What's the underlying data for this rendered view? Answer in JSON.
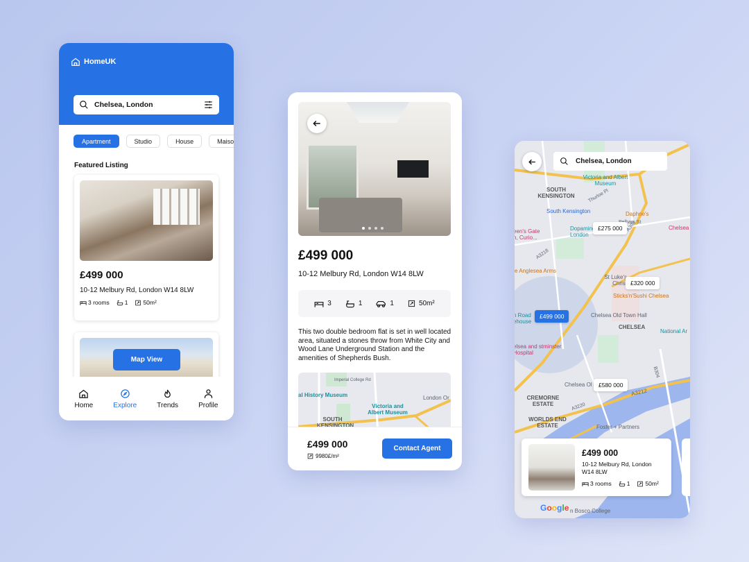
{
  "browse": {
    "brand": "HomeUK",
    "search_value": "Chelsea, London",
    "chips": [
      "Apartment",
      "Studio",
      "House",
      "Maisonette"
    ],
    "section_title": "Featured Listing",
    "listing": {
      "price": "£499 000",
      "address": "10-12 Melbury Rd, London W14 8LW",
      "rooms": "3 rooms",
      "baths": "1",
      "area": "50m²"
    },
    "map_view_label": "Map View",
    "nav": [
      {
        "label": "Home",
        "icon": "home-icon"
      },
      {
        "label": "Explore",
        "icon": "compass-icon"
      },
      {
        "label": "Trends",
        "icon": "flame-icon"
      },
      {
        "label": "Profile",
        "icon": "user-icon"
      }
    ],
    "active_nav": "Explore"
  },
  "detail": {
    "price": "£499 000",
    "address": "10-12 Melbury Rd, London W14 8LW",
    "features": {
      "beds": "3",
      "baths": "1",
      "parking": "1",
      "area": "50m²"
    },
    "description": "This two double bedroom flat is set in well located area, situated a stones throw from White City and Wood Lane Underground Station and the amenities of Shepherds Bush.",
    "map_labels": [
      "Imperial College Rd",
      "al History Museum",
      "Victoria and Albert Museum",
      "London Or",
      "SOUTH KENSINGTON"
    ],
    "footer_price": "£499 000",
    "price_per_m2": "9980£/m²",
    "contact_label": "Contact Agent",
    "carousel": {
      "count": 4,
      "active": 1
    }
  },
  "map": {
    "search_value": "Chelsea, London",
    "labels": [
      "SOUTH KENSINGTON",
      "Victoria and Albert Museum",
      "South Kensington",
      "Daphne's",
      "Chelsea",
      "een's Gate n, Curio...",
      "Dopamine London",
      "A3218",
      "A308",
      "e Anglesea Arms",
      "St Luke's Christ Church",
      "Sticks'n'Sushi Chelsea",
      "Chelsea Old Town Hall",
      "CHELSEA",
      "National Ar",
      "n Road ehouse",
      "elsea and stminster Hospital",
      "Chelsea Ol",
      "CREMORNE ESTATE",
      "WORLDS END ESTATE",
      "A3220",
      "A3212",
      "B304",
      "Foster + Partners",
      "n Bosco College",
      "Thurloe Pl",
      "Pelham St"
    ],
    "pins": [
      "£275 000",
      "£320 000",
      "£499 000",
      "£580 000"
    ],
    "selected_pin": "£499 000",
    "card": {
      "price": "£499 000",
      "address": "10-12 Melbury Rd, London W14 8LW",
      "rooms": "3 rooms",
      "baths": "1",
      "area": "50m²"
    },
    "google": "Google"
  },
  "colors": {
    "accent": "#2671e3",
    "water": "#9db7ee",
    "road": "#f2c14e",
    "map_bg": "#e6e8ee"
  }
}
